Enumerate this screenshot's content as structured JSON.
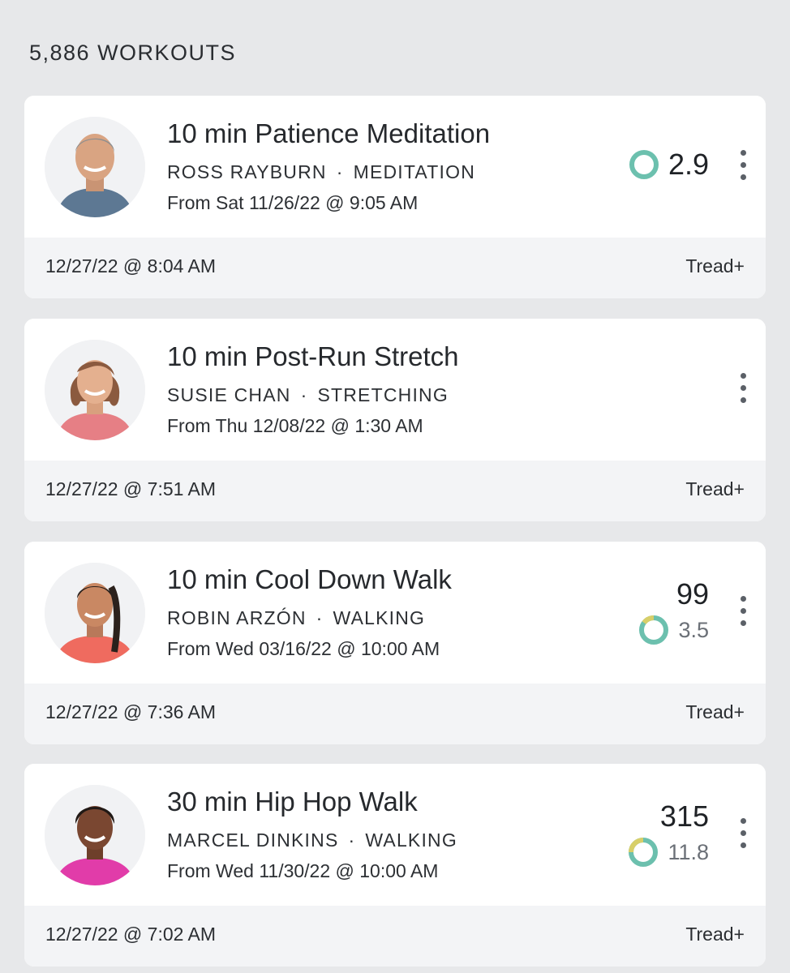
{
  "header": {
    "count_label": "5,886 WORKOUTS"
  },
  "colors": {
    "background": "#e7e8ea",
    "card": "#ffffff",
    "footer": "#f3f4f6",
    "strive_ring": "#6cc0ae",
    "strive_ring_partial": "#d8cf69",
    "menu_dots": "#5b6067"
  },
  "workouts": [
    {
      "title": "10 min Patience Meditation",
      "instructor": "ROSS RAYBURN",
      "separator": "·",
      "category": "MEDITATION",
      "from": "From Sat 11/26/22 @ 9:05 AM",
      "output": "",
      "strive_score": "2.9",
      "ring_icon": "strive-ring-icon",
      "completed_at": "12/27/22 @ 8:04 AM",
      "device": "Tread+"
    },
    {
      "title": "10 min Post-Run Stretch",
      "instructor": "SUSIE CHAN",
      "separator": "·",
      "category": "STRETCHING",
      "from": "From Thu 12/08/22 @ 1:30 AM",
      "output": "",
      "strive_score": "",
      "ring_icon": "",
      "completed_at": "12/27/22 @ 7:51 AM",
      "device": "Tread+"
    },
    {
      "title": "10 min Cool Down Walk",
      "instructor": "ROBIN ARZÓN",
      "separator": "·",
      "category": "WALKING",
      "from": "From Wed 03/16/22 @ 10:00 AM",
      "output": "99",
      "strive_score": "3.5",
      "ring_icon": "strive-ring-icon",
      "completed_at": "12/27/22 @ 7:36 AM",
      "device": "Tread+"
    },
    {
      "title": "30 min Hip Hop Walk",
      "instructor": "MARCEL DINKINS",
      "separator": "·",
      "category": "WALKING",
      "from": "From Wed 11/30/22 @ 10:00 AM",
      "output": "315",
      "strive_score": "11.8",
      "ring_icon": "strive-ring-icon",
      "completed_at": "12/27/22 @ 7:02 AM",
      "device": "Tread+"
    }
  ]
}
